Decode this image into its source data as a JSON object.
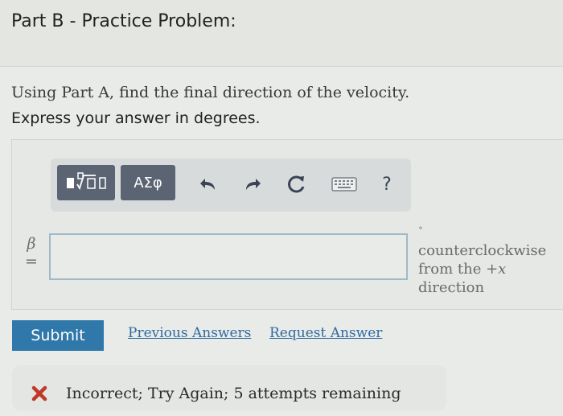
{
  "header": {
    "title": "Part B - Practice Problem:"
  },
  "question": {
    "line1": "Using Part A, find the final direction of the velocity.",
    "line2": "Express your answer in degrees."
  },
  "toolbar": {
    "greek_label": "ΑΣφ",
    "help_label": "?",
    "icons": [
      "templates-icon",
      "greek-symbols-icon",
      "undo-icon",
      "redo-icon",
      "reset-icon",
      "keyboard-icon",
      "help-icon"
    ]
  },
  "answer": {
    "variable": "β",
    "equals": "=",
    "value": "",
    "unit_symbol": "∘",
    "unit_line1": "counterclockwise",
    "unit_line2_prefix": "from the ",
    "unit_line2_axis": "+x",
    "unit_line3": "direction"
  },
  "actions": {
    "submit": "Submit",
    "previous_answers": "Previous Answers",
    "request_answer": "Request Answer"
  },
  "feedback": {
    "message": "Incorrect; Try Again; 5 attempts remaining",
    "icon_color": "#c0392b"
  },
  "colors": {
    "accent": "#2f78a9",
    "toolbar_button": "#5b6472",
    "link": "#2f6aa0"
  }
}
